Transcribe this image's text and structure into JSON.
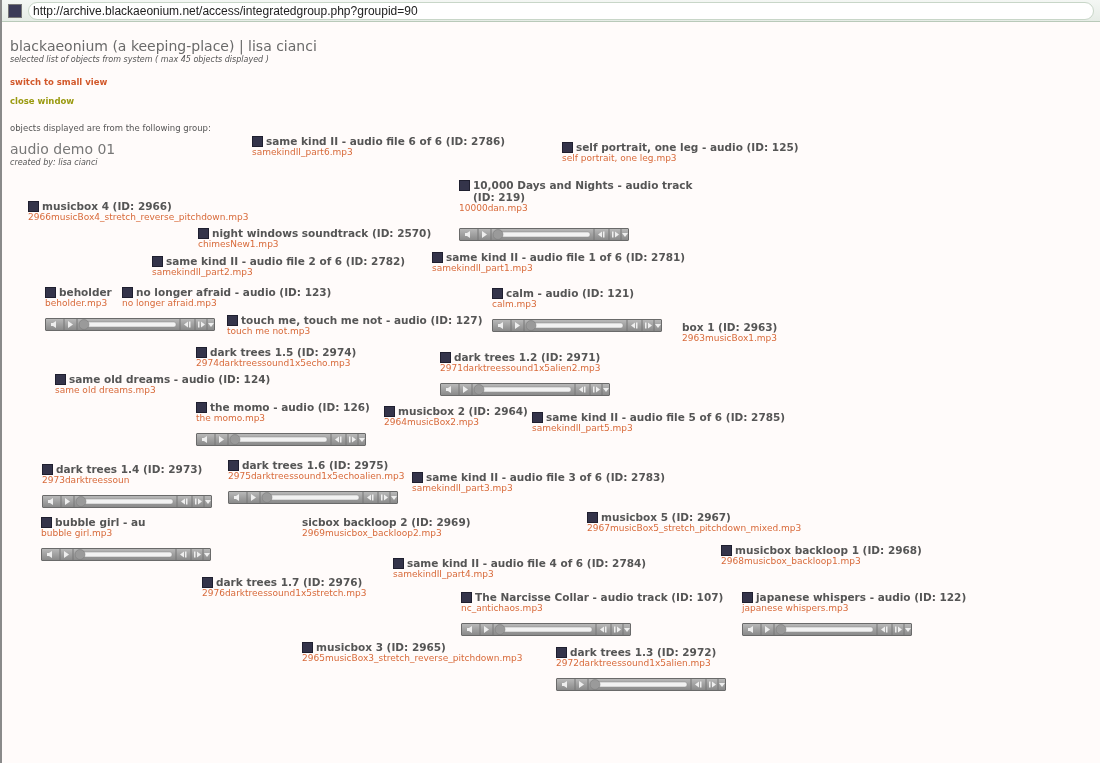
{
  "address_bar": {
    "url": "http://archive.blackaeonium.net/access/integratedgroup.php?groupid=90"
  },
  "header": {
    "title": "blackaeonium (a keeping-place) | lisa cianci",
    "subtitle": "selected list of objects from system ( max 45 objects displayed )"
  },
  "links": [
    {
      "label": "switch to small view",
      "kind": "switch"
    },
    {
      "label": "close window",
      "kind": "close"
    }
  ],
  "group": {
    "intro": "objects displayed are from the following group:",
    "name": "audio demo 01",
    "creator": "created by: lisa cianci"
  },
  "items": [
    {
      "title": "same kind II - audio file 6 of 6 (ID: 2786)",
      "file": "samekindII_part6.mp3",
      "kind": "plain"
    },
    {
      "title": "musicbox 4 (ID: 2966)",
      "file": "2966musicBox4_stretch_reverse_pitchdown.mp3",
      "kind": "plain"
    },
    {
      "title": "night windows soundtrack (ID: 2570)",
      "file": "chimesNew1.mp3",
      "kind": "plain"
    },
    {
      "title": "10,000 Days and Nights - audio track (ID: 219)",
      "file": "10000dan.mp3",
      "kind": "player"
    },
    {
      "title": "self portrait, one leg - audio (ID: 125)",
      "file": "self portrait, one leg.mp3",
      "kind": "plain"
    },
    {
      "title": "same kind II - audio file 2 of 6 (ID: 2782)",
      "file": "samekindII_part2.mp3",
      "kind": "plain"
    },
    {
      "title": "same kind II - audio file 1 of 6 (ID: 2781)",
      "file": "samekindII_part1.mp3",
      "kind": "plain"
    },
    {
      "title": "beholder",
      "file": "beholder.mp3",
      "kind": "player"
    },
    {
      "title": "no longer afraid - audio (ID: 123)",
      "file": "no longer afraid.mp3",
      "kind": "plain"
    },
    {
      "title": "touch me, touch me not - audio (ID: 127)",
      "file": "touch me not.mp3",
      "kind": "plain"
    },
    {
      "title": "calm - audio (ID: 121)",
      "file": "calm.mp3",
      "kind": "player"
    },
    {
      "title": "box 1 (ID: 2963)",
      "file": "2963musicBox1.mp3",
      "kind": "cut"
    },
    {
      "title": "dark trees 1.2 (ID: 2971)",
      "file": "2971darktreessound1x5alien2.mp3",
      "kind": "player"
    },
    {
      "title": "same old dreams - audio (ID: 124)",
      "file": "same old dreams.mp3",
      "kind": "plain"
    },
    {
      "title": "dark trees 1.5 (ID: 2974)",
      "file": "2974darktreessound1x5echo.mp3",
      "kind": "plain"
    },
    {
      "title": "the momo - audio (ID: 126)",
      "file": "the momo.mp3",
      "kind": "player"
    },
    {
      "title": "musicbox 2 (ID: 2964)",
      "file": "2964musicBox2.mp3",
      "kind": "plain"
    },
    {
      "title": "same kind II - audio file 5 of 6 (ID: 2785)",
      "file": "samekindII_part5.mp3",
      "kind": "plain"
    },
    {
      "title": "dark trees 1.6 (ID: 2975)",
      "file": "2975darktreessound1x5echoalien.mp3",
      "kind": "player"
    },
    {
      "title": "same kind II - audio file 3 of 6 (ID: 2783)",
      "file": "samekindII_part3.mp3",
      "kind": "plain"
    },
    {
      "title": "dark trees 1.4 (ID: 2973)",
      "file": "2973darktreessoun",
      "kind": "player"
    },
    {
      "title": "bubble girl - au",
      "file": "bubble girl.mp3",
      "kind": "player"
    },
    {
      "title": "sicbox backloop 2 (ID: 2969)",
      "file": "2969musicbox_backloop2.mp3",
      "kind": "cut"
    },
    {
      "title": "musicbox 5 (ID: 2967)",
      "file": "2967musicBox5_stretch_pitchdown_mixed.mp3",
      "kind": "plain"
    },
    {
      "title": "musicbox backloop 1 (ID: 2968)",
      "file": "2968musicbox_backloop1.mp3",
      "kind": "plain"
    },
    {
      "title": "same kind II - audio file 4 of 6 (ID: 2784)",
      "file": "samekindII_part4.mp3",
      "kind": "plain"
    },
    {
      "title": "dark trees 1.7 (ID: 2976)",
      "file": "2976darktreessound1x5stretch.mp3",
      "kind": "plain"
    },
    {
      "title": "The Narcisse Collar - audio track (ID: 107)",
      "file": "nc_antichaos.mp3",
      "kind": "player"
    },
    {
      "title": "musicbox 3 (ID: 2965)",
      "file": "2965musicBox3_stretch_reverse_pitchdown.mp3",
      "kind": "plain"
    },
    {
      "title": "dark trees 1.3 (ID: 2972)",
      "file": "2972darktreessound1x5alien.mp3",
      "kind": "player"
    },
    {
      "title": "japanese whispers - audio (ID: 122)",
      "file": "japanese whispers.mp3",
      "kind": "player"
    }
  ]
}
